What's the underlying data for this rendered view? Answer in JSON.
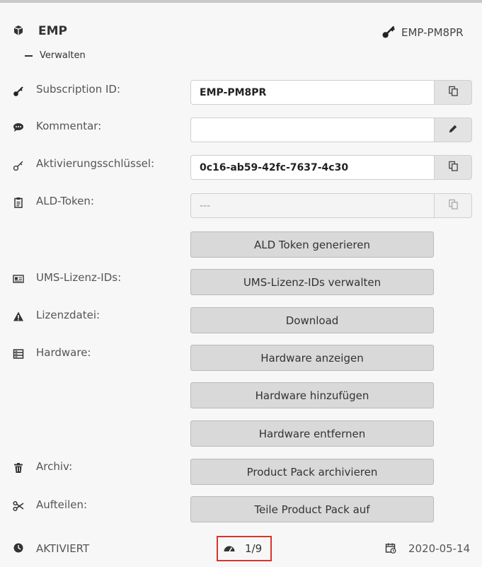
{
  "header": {
    "product_name": "EMP",
    "subscription_short": "EMP-PM8PR",
    "manage_label": "Verwalten"
  },
  "rows": {
    "subscription": {
      "label": "Subscription ID:",
      "value": "EMP-PM8PR"
    },
    "comment": {
      "label": "Kommentar:",
      "value": ""
    },
    "activation": {
      "label": "Aktivierungsschlüssel:",
      "value": "0c16-ab59-42fc-7637-4c30"
    },
    "ald": {
      "label": "ALD-Token:",
      "value": "---",
      "button": "ALD Token generieren"
    },
    "ums": {
      "label": "UMS-Lizenz-IDs:",
      "button": "UMS-Lizenz-IDs verwalten"
    },
    "license": {
      "label": "Lizenzdatei:",
      "button": "Download"
    },
    "hardware": {
      "label": "Hardware:",
      "show": "Hardware anzeigen",
      "add": "Hardware hinzufügen",
      "remove": "Hardware entfernen"
    },
    "archive": {
      "label": "Archiv:",
      "button": "Product Pack archivieren"
    },
    "split": {
      "label": "Aufteilen:",
      "button": "Teile Product Pack auf"
    }
  },
  "footer": {
    "status": "AKTIVIERT",
    "usage": "1/9",
    "date": "2020-05-14"
  },
  "icons": {
    "product": "cube-icon",
    "key": "key-icon",
    "comment": "comment-icon",
    "copy": "copy-icon",
    "edit": "pencil-icon",
    "clipboard": "clipboard-icon",
    "idcard": "id-card-icon",
    "warning": "warning-icon",
    "hardware": "hardware-icon",
    "trash": "trash-icon",
    "scissors": "scissors-icon",
    "status": "status-dot-icon",
    "gauge": "gauge-icon",
    "calendar": "calendar-icon"
  },
  "colors": {
    "highlight": "#d9342b"
  }
}
